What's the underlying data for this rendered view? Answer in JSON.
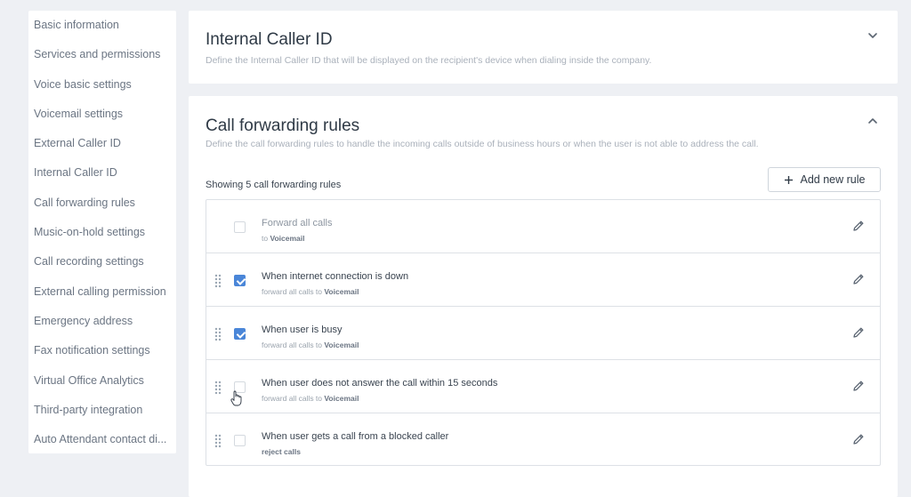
{
  "sidebar": {
    "items": [
      {
        "label": "Basic information"
      },
      {
        "label": "Services and permissions"
      },
      {
        "label": "Voice basic settings"
      },
      {
        "label": "Voicemail settings"
      },
      {
        "label": "External Caller ID"
      },
      {
        "label": "Internal Caller ID"
      },
      {
        "label": "Call forwarding rules"
      },
      {
        "label": "Music-on-hold settings"
      },
      {
        "label": "Call recording settings"
      },
      {
        "label": "External calling permission"
      },
      {
        "label": "Emergency address"
      },
      {
        "label": "Fax notification settings"
      },
      {
        "label": "Virtual Office Analytics"
      },
      {
        "label": "Third-party integration"
      },
      {
        "label": "Auto Attendant contact di..."
      }
    ]
  },
  "internal_caller_id": {
    "title": "Internal Caller ID",
    "description": "Define the Internal Caller ID that will be displayed on the recipient's device when dialing inside the company.",
    "chevron_icon": "chevron-down-icon"
  },
  "call_forwarding": {
    "title": "Call forwarding rules",
    "description": "Define the call forwarding rules to handle the incoming calls outside of business hours or when the user is not able to address the call.",
    "chevron_icon": "chevron-up-icon",
    "showing_text": "Showing 5 call forwarding rules",
    "add_button_label": "Add new rule",
    "rules": [
      {
        "title": "Forward all calls",
        "sub_prefix": "to ",
        "sub_target": "Voicemail",
        "checked": false,
        "draggable": false
      },
      {
        "title": "When internet connection is down",
        "sub_prefix": "forward all calls to ",
        "sub_target": "Voicemail",
        "checked": true,
        "draggable": true
      },
      {
        "title": "When user is busy",
        "sub_prefix": "forward all calls to ",
        "sub_target": "Voicemail",
        "checked": true,
        "draggable": true
      },
      {
        "title": "When user does not answer the call within 15 seconds",
        "sub_prefix": "forward all calls to ",
        "sub_target": "Voicemail",
        "checked": false,
        "draggable": true
      },
      {
        "title": "When user gets a call from a blocked caller",
        "sub_prefix": "",
        "sub_target": "reject calls",
        "checked": false,
        "draggable": true
      }
    ]
  },
  "colors": {
    "accent": "#4a86d8",
    "background": "#eef0f4"
  }
}
